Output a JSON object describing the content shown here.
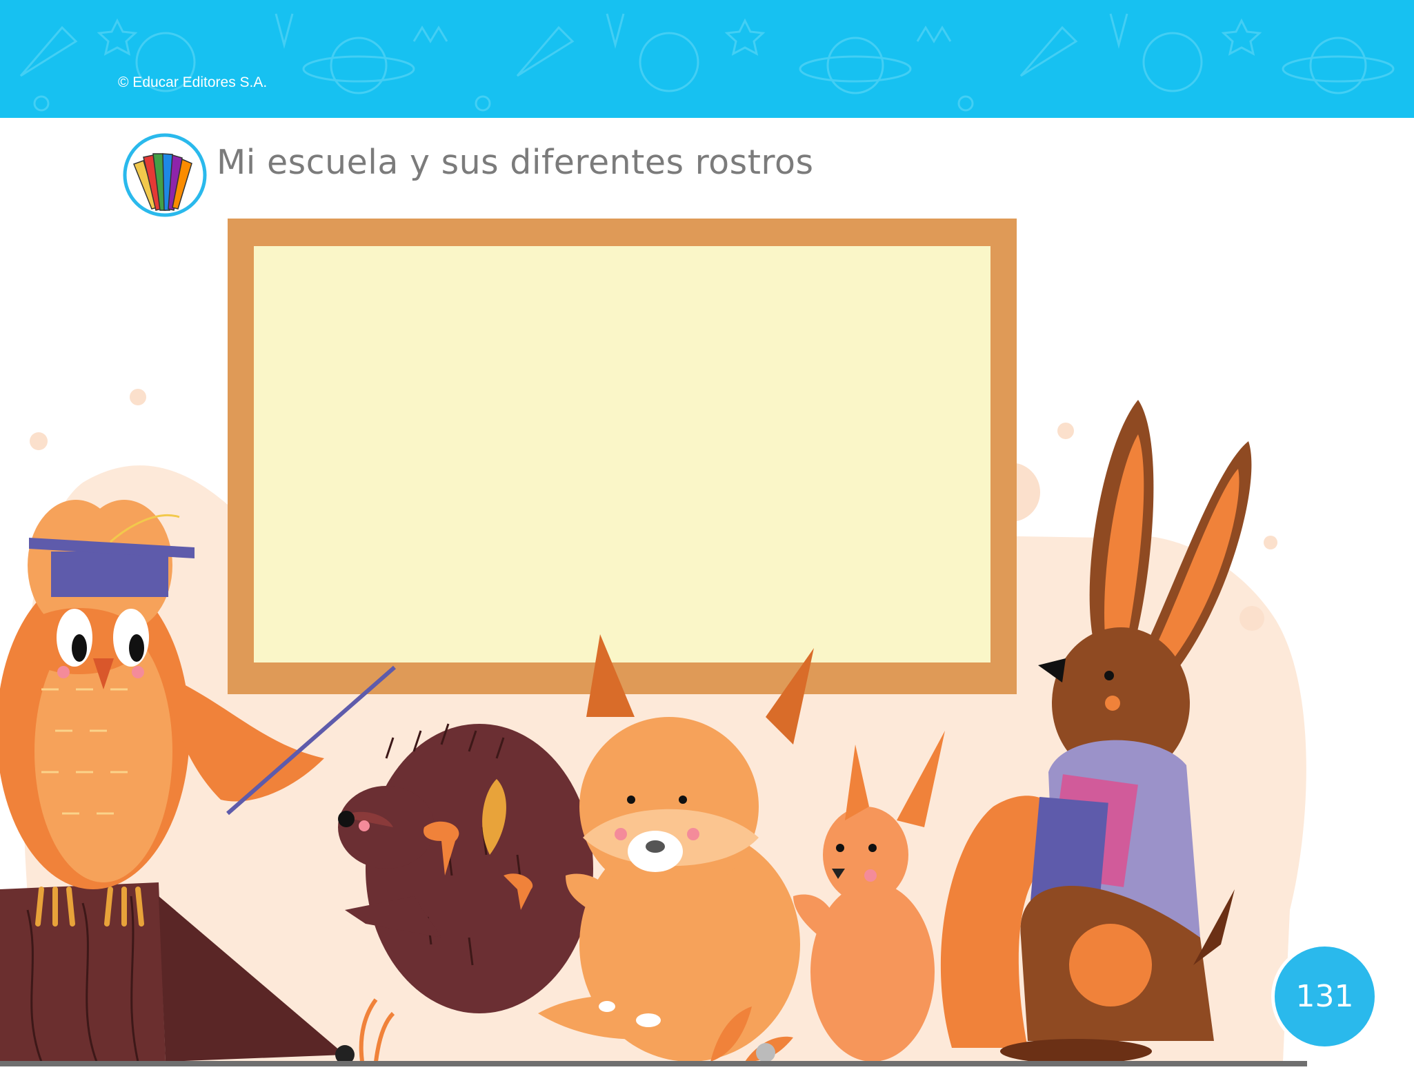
{
  "header": {
    "copyright": "© Educar Editores S.A."
  },
  "title": {
    "text": "Mi escuela y sus diferentes rostros",
    "logo_icon": "colored-pencils-icon"
  },
  "illustration": {
    "characters": [
      "owl-teacher",
      "hedgehog",
      "fox",
      "squirrel",
      "rabbit"
    ],
    "board_fill": "#faf6c8",
    "board_frame": "#df9a57"
  },
  "footer": {
    "page_number": "131",
    "badge_color": "#2ab9ec"
  },
  "colors": {
    "banner": "#17c1f1",
    "title_text": "#7b7b7b"
  }
}
